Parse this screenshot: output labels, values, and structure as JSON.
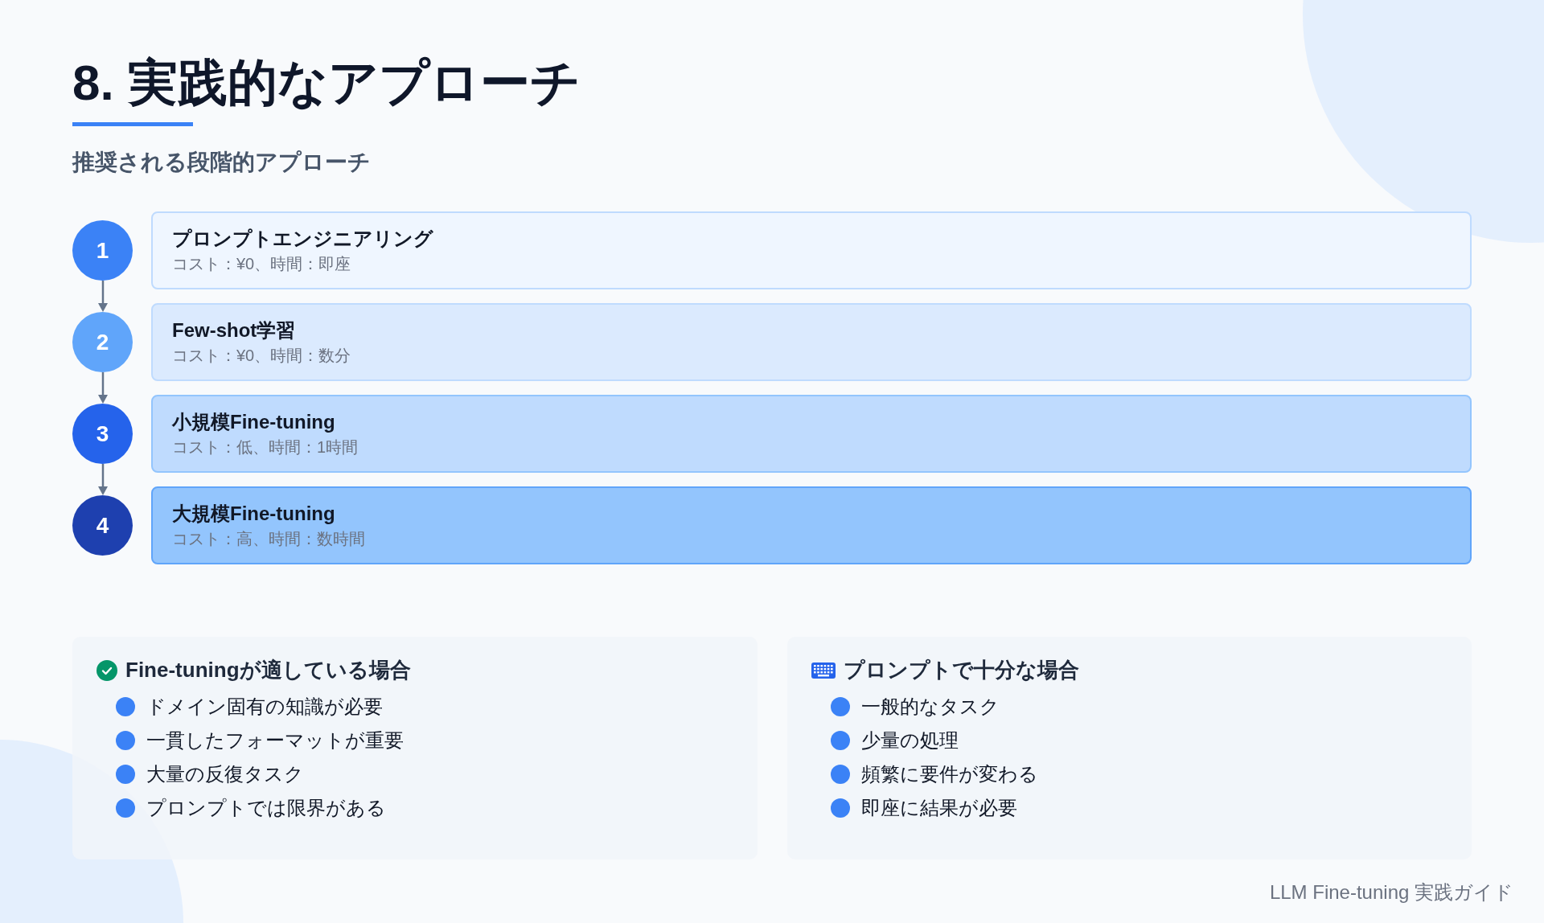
{
  "title": "8. 実践的なアプローチ",
  "subtitle": "推奨される段階的アプローチ",
  "steps": [
    {
      "number": "1",
      "title": "プロンプトエンジニアリング",
      "detail": "コスト：¥0、時間：即座",
      "color": "#3b82f6"
    },
    {
      "number": "2",
      "title": "Few-shot学習",
      "detail": "コスト：¥0、時間：数分",
      "color": "#60a5fa"
    },
    {
      "number": "3",
      "title": "小規模Fine-tuning",
      "detail": "コスト：低、時間：1時間",
      "color": "#2563eb"
    },
    {
      "number": "4",
      "title": "大規模Fine-tuning",
      "detail": "コスト：高、時間：数時間",
      "color": "#1e40af"
    }
  ],
  "panels": [
    {
      "kind": "check",
      "heading": "Fine-tuningが適している場合",
      "items": [
        "ドメイン固有の知識が必要",
        "一貫したフォーマットが重要",
        "大量の反復タスク",
        "プロンプトでは限界がある"
      ]
    },
    {
      "kind": "keyboard",
      "heading": "プロンプトで十分な場合",
      "items": [
        "一般的なタスク",
        "少量の処理",
        "頻繁に要件が変わる",
        "即座に結果が必要"
      ]
    }
  ],
  "footer": "LLM Fine-tuning 実践ガイド"
}
